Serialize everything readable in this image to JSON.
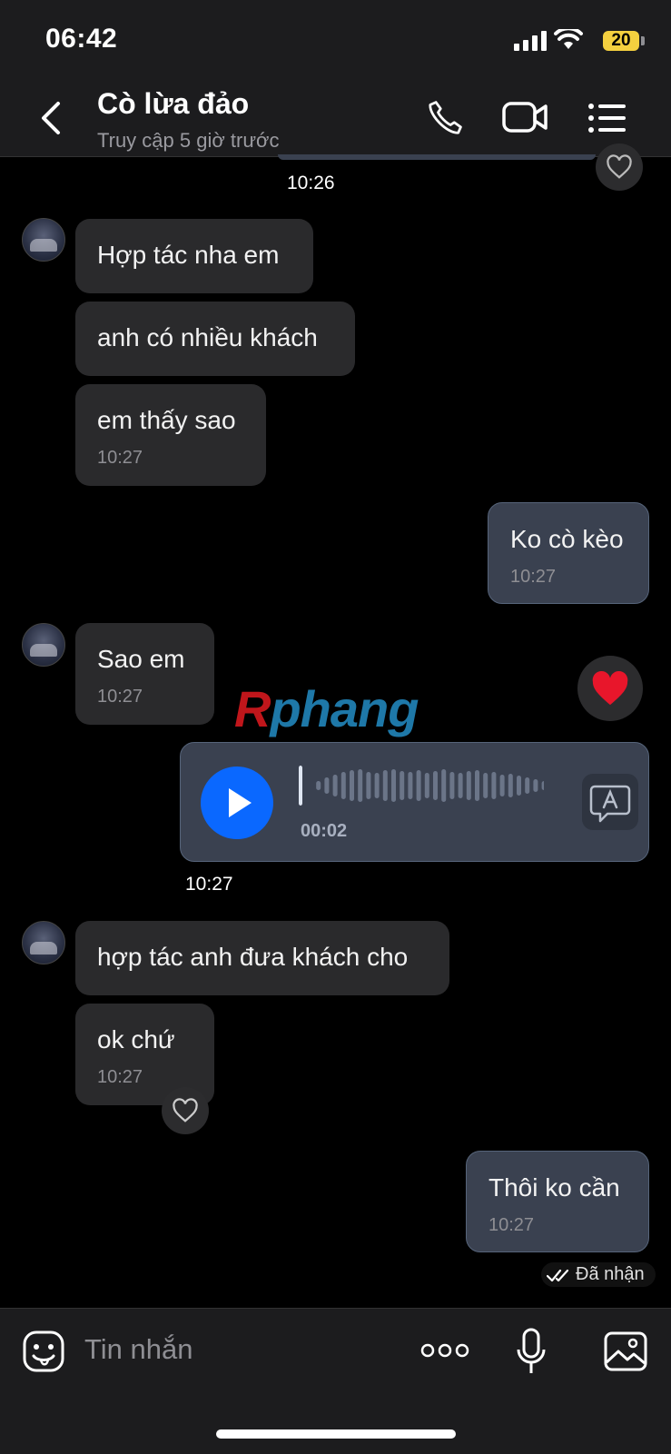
{
  "status_bar": {
    "time": "06:42",
    "battery": "20"
  },
  "header": {
    "title": "Cò lừa đảo",
    "subtitle": "Truy cập 5 giờ trước"
  },
  "messages": [
    {
      "time": "10:26"
    },
    {
      "text": "Hợp tác nha em"
    },
    {
      "text": "anh có nhiều khách"
    },
    {
      "text": "em thấy sao",
      "time": "10:27"
    },
    {
      "text": "Ko cò kèo",
      "time": "10:27"
    },
    {
      "text": "Sao em",
      "time": "10:27"
    },
    {
      "voice_duration": "00:02",
      "time": "10:27"
    },
    {
      "text": "hợp tác anh đưa khách cho"
    },
    {
      "text": "ok chứ",
      "time": "10:27"
    },
    {
      "text": "Thôi ko cần",
      "time": "10:27",
      "status": "Đã nhận"
    }
  ],
  "watermark": {
    "first": "R",
    "rest": "phang"
  },
  "composer": {
    "placeholder": "Tin nhắn"
  },
  "colors": {
    "background": "#000000",
    "incoming_bubble": "#2a2a2c",
    "outgoing_bubble": "#3a4150",
    "play_button": "#0a68ff",
    "battery": "#f4d03f"
  }
}
